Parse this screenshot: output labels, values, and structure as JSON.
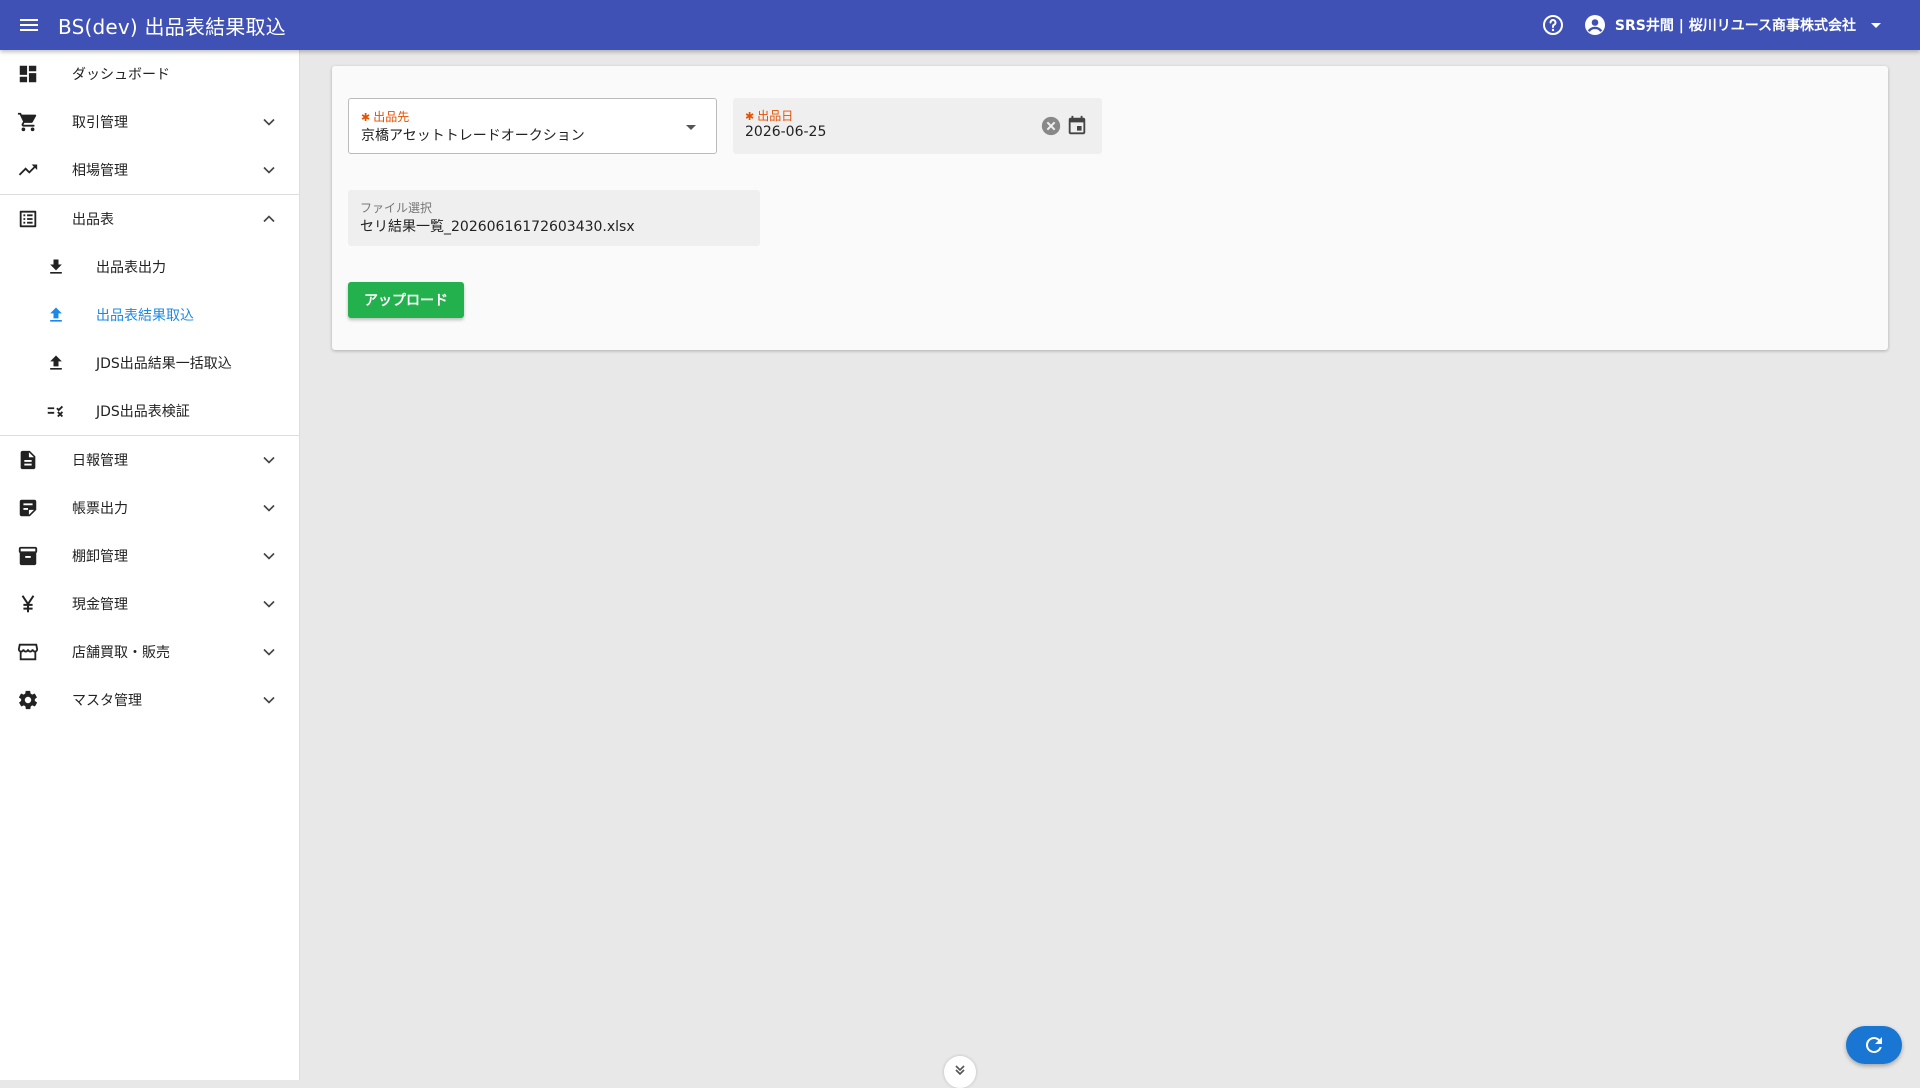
{
  "app": {
    "title": "BS(dev) 出品表結果取込"
  },
  "header": {
    "user_name": "SRS井間 | 桜川リユース商事株式会社"
  },
  "sidebar": {
    "items": [
      {
        "label": "ダッシュボード"
      },
      {
        "label": "取引管理"
      },
      {
        "label": "相場管理"
      },
      {
        "label": "出品表"
      },
      {
        "label": "日報管理"
      },
      {
        "label": "帳票出力"
      },
      {
        "label": "棚卸管理"
      },
      {
        "label": "現金管理"
      },
      {
        "label": "店舗買取・販売"
      },
      {
        "label": "マスタ管理"
      }
    ],
    "sub_items": [
      {
        "label": "出品表出力"
      },
      {
        "label": "出品表結果取込"
      },
      {
        "label": "JDS出品結果一括取込"
      },
      {
        "label": "JDS出品表検証"
      }
    ]
  },
  "form": {
    "destination": {
      "required_mark": "✱",
      "label": "出品先",
      "value": "京橋アセットトレードオークション"
    },
    "date": {
      "required_mark": "✱",
      "label": "出品日",
      "value": "2026-06-25"
    },
    "file": {
      "label": "ファイル選択",
      "value": "セリ結果一覧_20260616172603430.xlsx"
    },
    "upload_label": "アップロード"
  },
  "colors": {
    "appbar": "#3f51b5",
    "accent": "#1e88e5",
    "upload": "#22b14c",
    "required": "#e65100"
  }
}
